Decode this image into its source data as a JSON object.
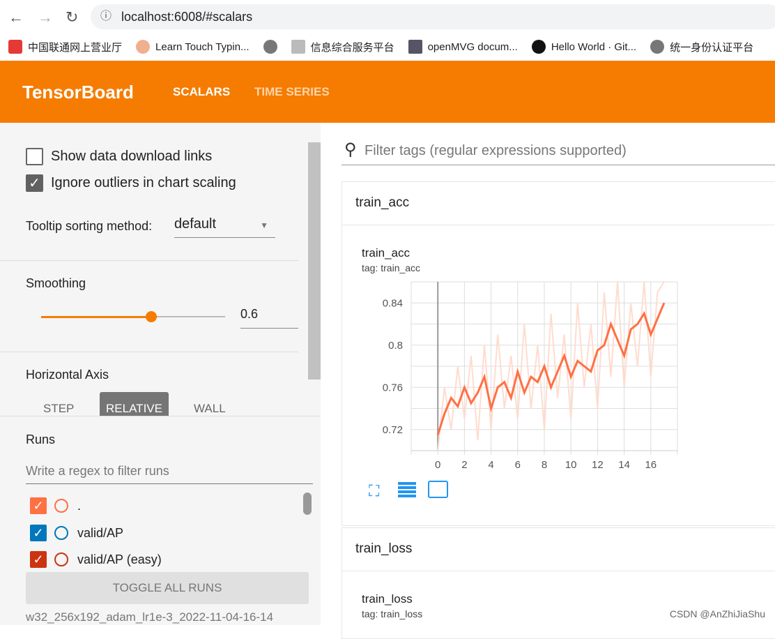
{
  "browser": {
    "url": "localhost:6008/#scalars",
    "bookmarks": [
      "中国联通网上营业厅",
      "Learn Touch Typin...",
      "",
      "信息综合服务平台",
      "openMVG docum...",
      "Hello World · Git...",
      "统一身份认证平台"
    ]
  },
  "header": {
    "title": "TensorBoard",
    "tabs": [
      {
        "label": "SCALARS",
        "active": true
      },
      {
        "label": "TIME SERIES",
        "active": false
      }
    ],
    "color": "#f57c00"
  },
  "sidebar": {
    "show_download": {
      "label": "Show data download links",
      "checked": false
    },
    "ignore_outliers": {
      "label": "Ignore outliers in chart scaling",
      "checked": true
    },
    "tooltip_label": "Tooltip sorting method:",
    "tooltip_value": "default",
    "smoothing_label": "Smoothing",
    "smoothing_value": "0.6",
    "smoothing_fraction": 0.6,
    "haxis_label": "Horizontal Axis",
    "haxis_options": [
      "STEP",
      "RELATIVE",
      "WALL"
    ],
    "haxis_selected": "RELATIVE",
    "runs_label": "Runs",
    "runs_filter_placeholder": "Write a regex to filter runs",
    "runs": [
      {
        "name": ".",
        "color": "#ff7043",
        "checked": true
      },
      {
        "name": "valid/AP",
        "color": "#0077bb",
        "checked": true
      },
      {
        "name": "valid/AP (easy)",
        "color": "#cc3311",
        "checked": true
      }
    ],
    "toggle_all": "TOGGLE ALL RUNS",
    "run_dir": "w32_256x192_adam_lr1e-3_2022-11-04-16-14"
  },
  "main": {
    "filter_placeholder": "Filter tags (regular expressions supported)",
    "groups": [
      {
        "name": "train_acc",
        "chart_title": "train_acc",
        "chart_tag": "tag: train_acc"
      },
      {
        "name": "train_loss",
        "chart_title": "train_loss",
        "chart_tag": "tag: train_loss"
      }
    ]
  },
  "watermark": "CSDN @AnZhiJiaShu",
  "chart_data": {
    "type": "line",
    "title": "train_acc",
    "xlabel": "",
    "ylabel": "",
    "xlim": [
      -2,
      18
    ],
    "ylim": [
      0.7,
      0.86
    ],
    "xticks": [
      0,
      2,
      4,
      6,
      8,
      10,
      12,
      14,
      16
    ],
    "yticks": [
      0.72,
      0.76,
      0.8,
      0.84
    ],
    "grid": true,
    "x": [
      0,
      0.5,
      1,
      1.5,
      2,
      2.5,
      3,
      3.5,
      4,
      4.5,
      5,
      5.5,
      6,
      6.5,
      7,
      7.5,
      8,
      8.5,
      9,
      9.5,
      10,
      10.5,
      11,
      11.5,
      12,
      12.5,
      13,
      13.5,
      14,
      14.5,
      15,
      15.5,
      16,
      16.5,
      17
    ],
    "series": [
      {
        "role": "smoothed",
        "color": "#ff7043",
        "values": [
          0.715,
          0.735,
          0.75,
          0.742,
          0.76,
          0.745,
          0.755,
          0.77,
          0.74,
          0.76,
          0.765,
          0.75,
          0.775,
          0.755,
          0.77,
          0.765,
          0.78,
          0.76,
          0.775,
          0.79,
          0.77,
          0.785,
          0.78,
          0.775,
          0.795,
          0.8,
          0.82,
          0.805,
          0.79,
          0.815,
          0.82,
          0.83,
          0.81,
          0.825,
          0.84
        ]
      },
      {
        "role": "raw",
        "color": "#ffdccf",
        "values": [
          0.7,
          0.76,
          0.72,
          0.78,
          0.73,
          0.79,
          0.71,
          0.8,
          0.72,
          0.81,
          0.74,
          0.79,
          0.73,
          0.82,
          0.74,
          0.8,
          0.72,
          0.83,
          0.75,
          0.81,
          0.73,
          0.84,
          0.76,
          0.82,
          0.74,
          0.85,
          0.77,
          0.86,
          0.76,
          0.84,
          0.78,
          0.86,
          0.77,
          0.85,
          0.86
        ]
      }
    ]
  }
}
